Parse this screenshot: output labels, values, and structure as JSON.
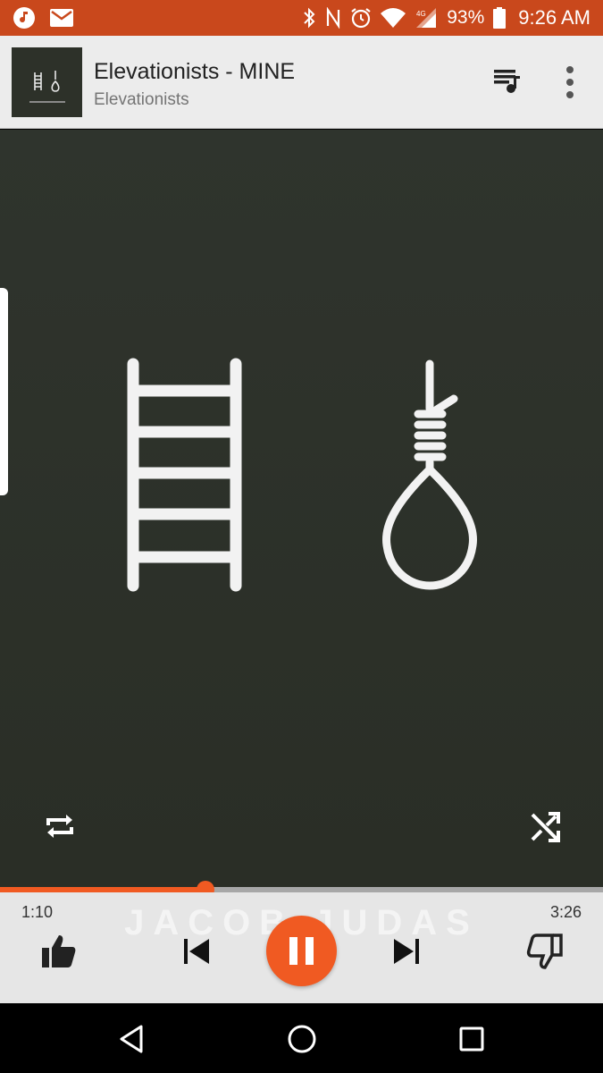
{
  "status_bar": {
    "battery_percent": "93%",
    "time": "9:26 AM",
    "background": "#c9481c"
  },
  "now_playing": {
    "title": "Elevationists - MINE",
    "artist": "Elevationists"
  },
  "artwork": {
    "watermark": "JACOB   JUDAS"
  },
  "playback": {
    "elapsed": "1:10",
    "total": "3:26",
    "progress_fraction": 0.34,
    "accent": "#f05a22"
  },
  "icons": {
    "status_left": [
      "music-note-icon",
      "mail-icon"
    ],
    "status_right": [
      "bluetooth-icon",
      "nfc-icon",
      "alarm-icon",
      "wifi-icon",
      "cellular-4g-icon",
      "battery-icon"
    ],
    "header": [
      "queue-icon",
      "more-vert-icon"
    ],
    "player": [
      "repeat-icon",
      "shuffle-icon",
      "thumbs-up-icon",
      "skip-previous-icon",
      "pause-icon",
      "skip-next-icon",
      "thumbs-down-icon"
    ],
    "nav": [
      "back-icon",
      "home-icon",
      "recents-icon"
    ]
  }
}
